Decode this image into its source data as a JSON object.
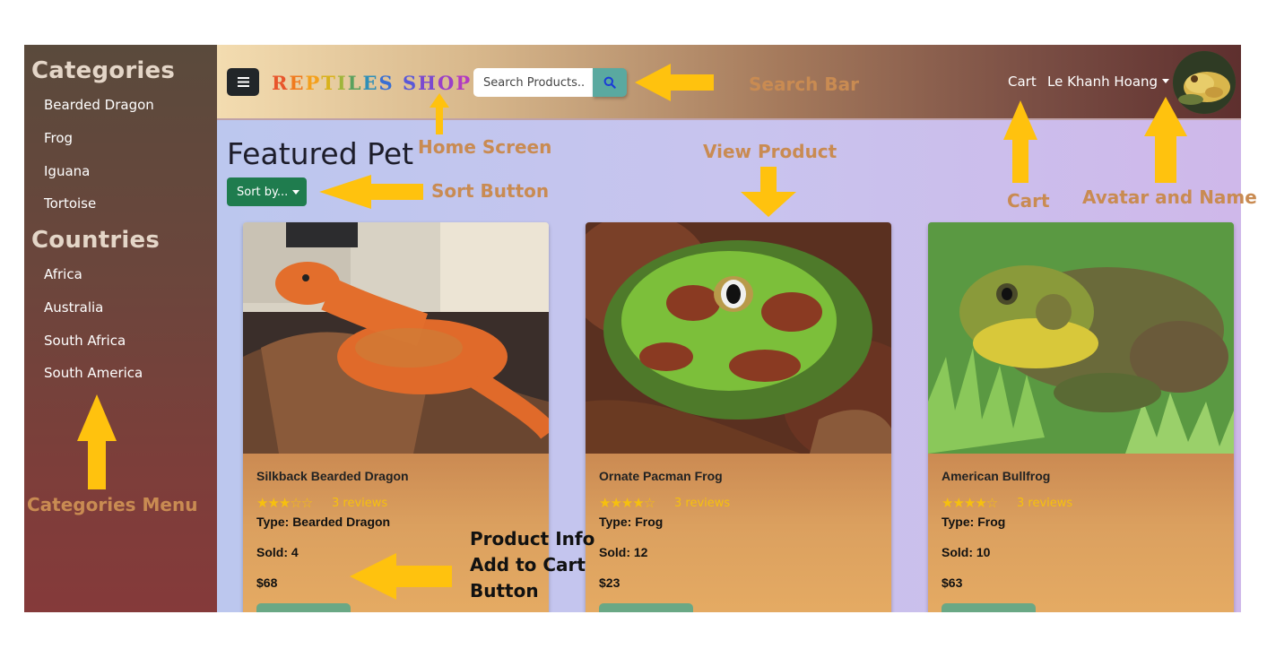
{
  "sidebar": {
    "categories_heading": "Categories",
    "categories": [
      "Bearded Dragon",
      "Frog",
      "Iguana",
      "Tortoise"
    ],
    "countries_heading": "Countries",
    "countries": [
      "Africa",
      "Australia",
      "South Africa",
      "South America"
    ]
  },
  "header": {
    "brand_letters": [
      "R",
      "E",
      "P",
      "T",
      "I",
      "L",
      "E",
      "S",
      " ",
      "S",
      "H",
      "O",
      "P"
    ],
    "search_placeholder": "Search Products...",
    "cart_label": "Cart",
    "user_name": "Le Khanh Hoang"
  },
  "main": {
    "title": "Featured Pet",
    "sort_label": "Sort by...",
    "products": [
      {
        "name": "Silkback Bearded Dragon",
        "stars": "★★★☆☆",
        "rating": 3,
        "reviews": "3 reviews",
        "type": "Type: Bearded Dragon",
        "sold": "Sold: 4",
        "price": "$68"
      },
      {
        "name": "Ornate Pacman Frog",
        "stars": "★★★★☆",
        "rating": 4,
        "reviews": "3 reviews",
        "type": "Type: Frog",
        "sold": "Sold: 12",
        "price": "$23"
      },
      {
        "name": "American Bullfrog",
        "stars": "★★★★☆",
        "rating": 4,
        "reviews": "3 reviews",
        "type": "Type: Frog",
        "sold": "Sold: 10",
        "price": "$63"
      }
    ]
  },
  "annotations": {
    "search_bar": "Search Bar",
    "home_screen": "Home Screen",
    "view_product": "View Product",
    "sort_button": "Sort Button",
    "cart": "Cart",
    "avatar_and_name": "Avatar and Name",
    "categories_menu": "Categories Menu",
    "product_info_line1": "Product Info",
    "product_info_line2": "Add to Cart",
    "product_info_line3": "Button"
  },
  "colors": {
    "accent_green": "#1f7c4e",
    "arrow_yellow": "#ffc20e",
    "annotation_text": "#c98b52"
  }
}
